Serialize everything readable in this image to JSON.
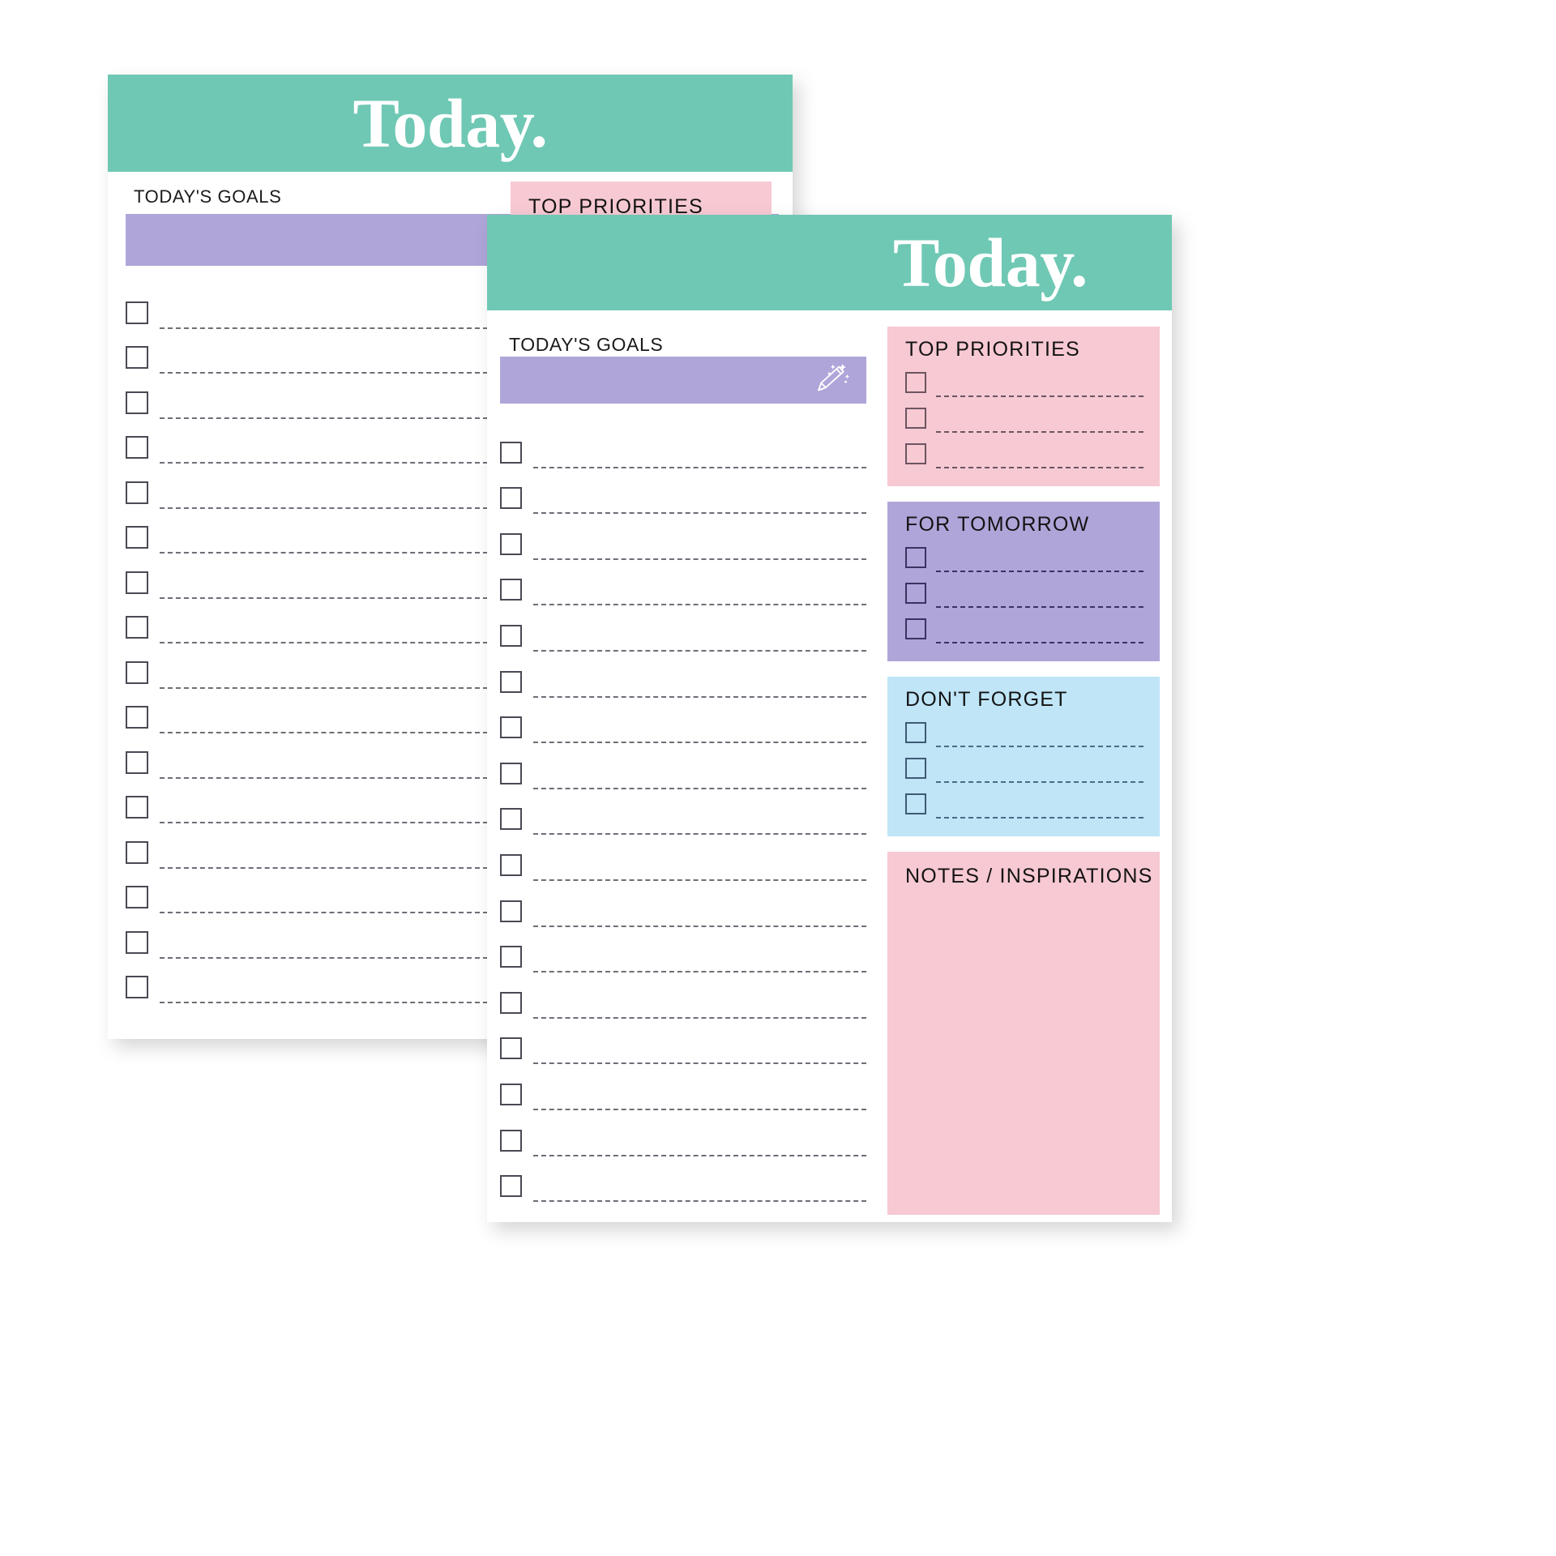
{
  "background_color": "#ffffff",
  "palette": {
    "teal_header": "#6fc8b4",
    "purple_bar": "#b0a5d9",
    "pink_box": "#f7c9d3",
    "blue_box": "#bfe5f7",
    "card_white": "#ffffff",
    "ink": "#1b1b1b",
    "dashed_line": "#6e6e78"
  },
  "back_card": {
    "header": {
      "title": "Today.",
      "align": "center"
    },
    "goals_label": "TODAY'S GOALS",
    "write_bar": {
      "icon": "sparkle-pencil-icon"
    },
    "goals_rows": 16,
    "top_priorities": {
      "title": "TOP PRIORITIES"
    }
  },
  "front_card": {
    "header": {
      "title": "Today.",
      "align": "right"
    },
    "goals_label": "TODAY'S GOALS",
    "write_bar": {
      "icon": "sparkle-pencil-icon"
    },
    "goals_rows": 17,
    "right_boxes": [
      {
        "id": "top-priorities",
        "title": "TOP PRIORITIES",
        "color": "#f7c9d3",
        "rows": 3
      },
      {
        "id": "for-tomorrow",
        "title": "FOR TOMORROW",
        "color": "#b0a5d9",
        "rows": 3
      },
      {
        "id": "dont-forget",
        "title": "DON'T FORGET",
        "color": "#bfe5f7",
        "rows": 3
      },
      {
        "id": "notes",
        "title": "NOTES / INSPIRATIONS",
        "color": "#f7c9d3",
        "rows": 0
      }
    ]
  }
}
